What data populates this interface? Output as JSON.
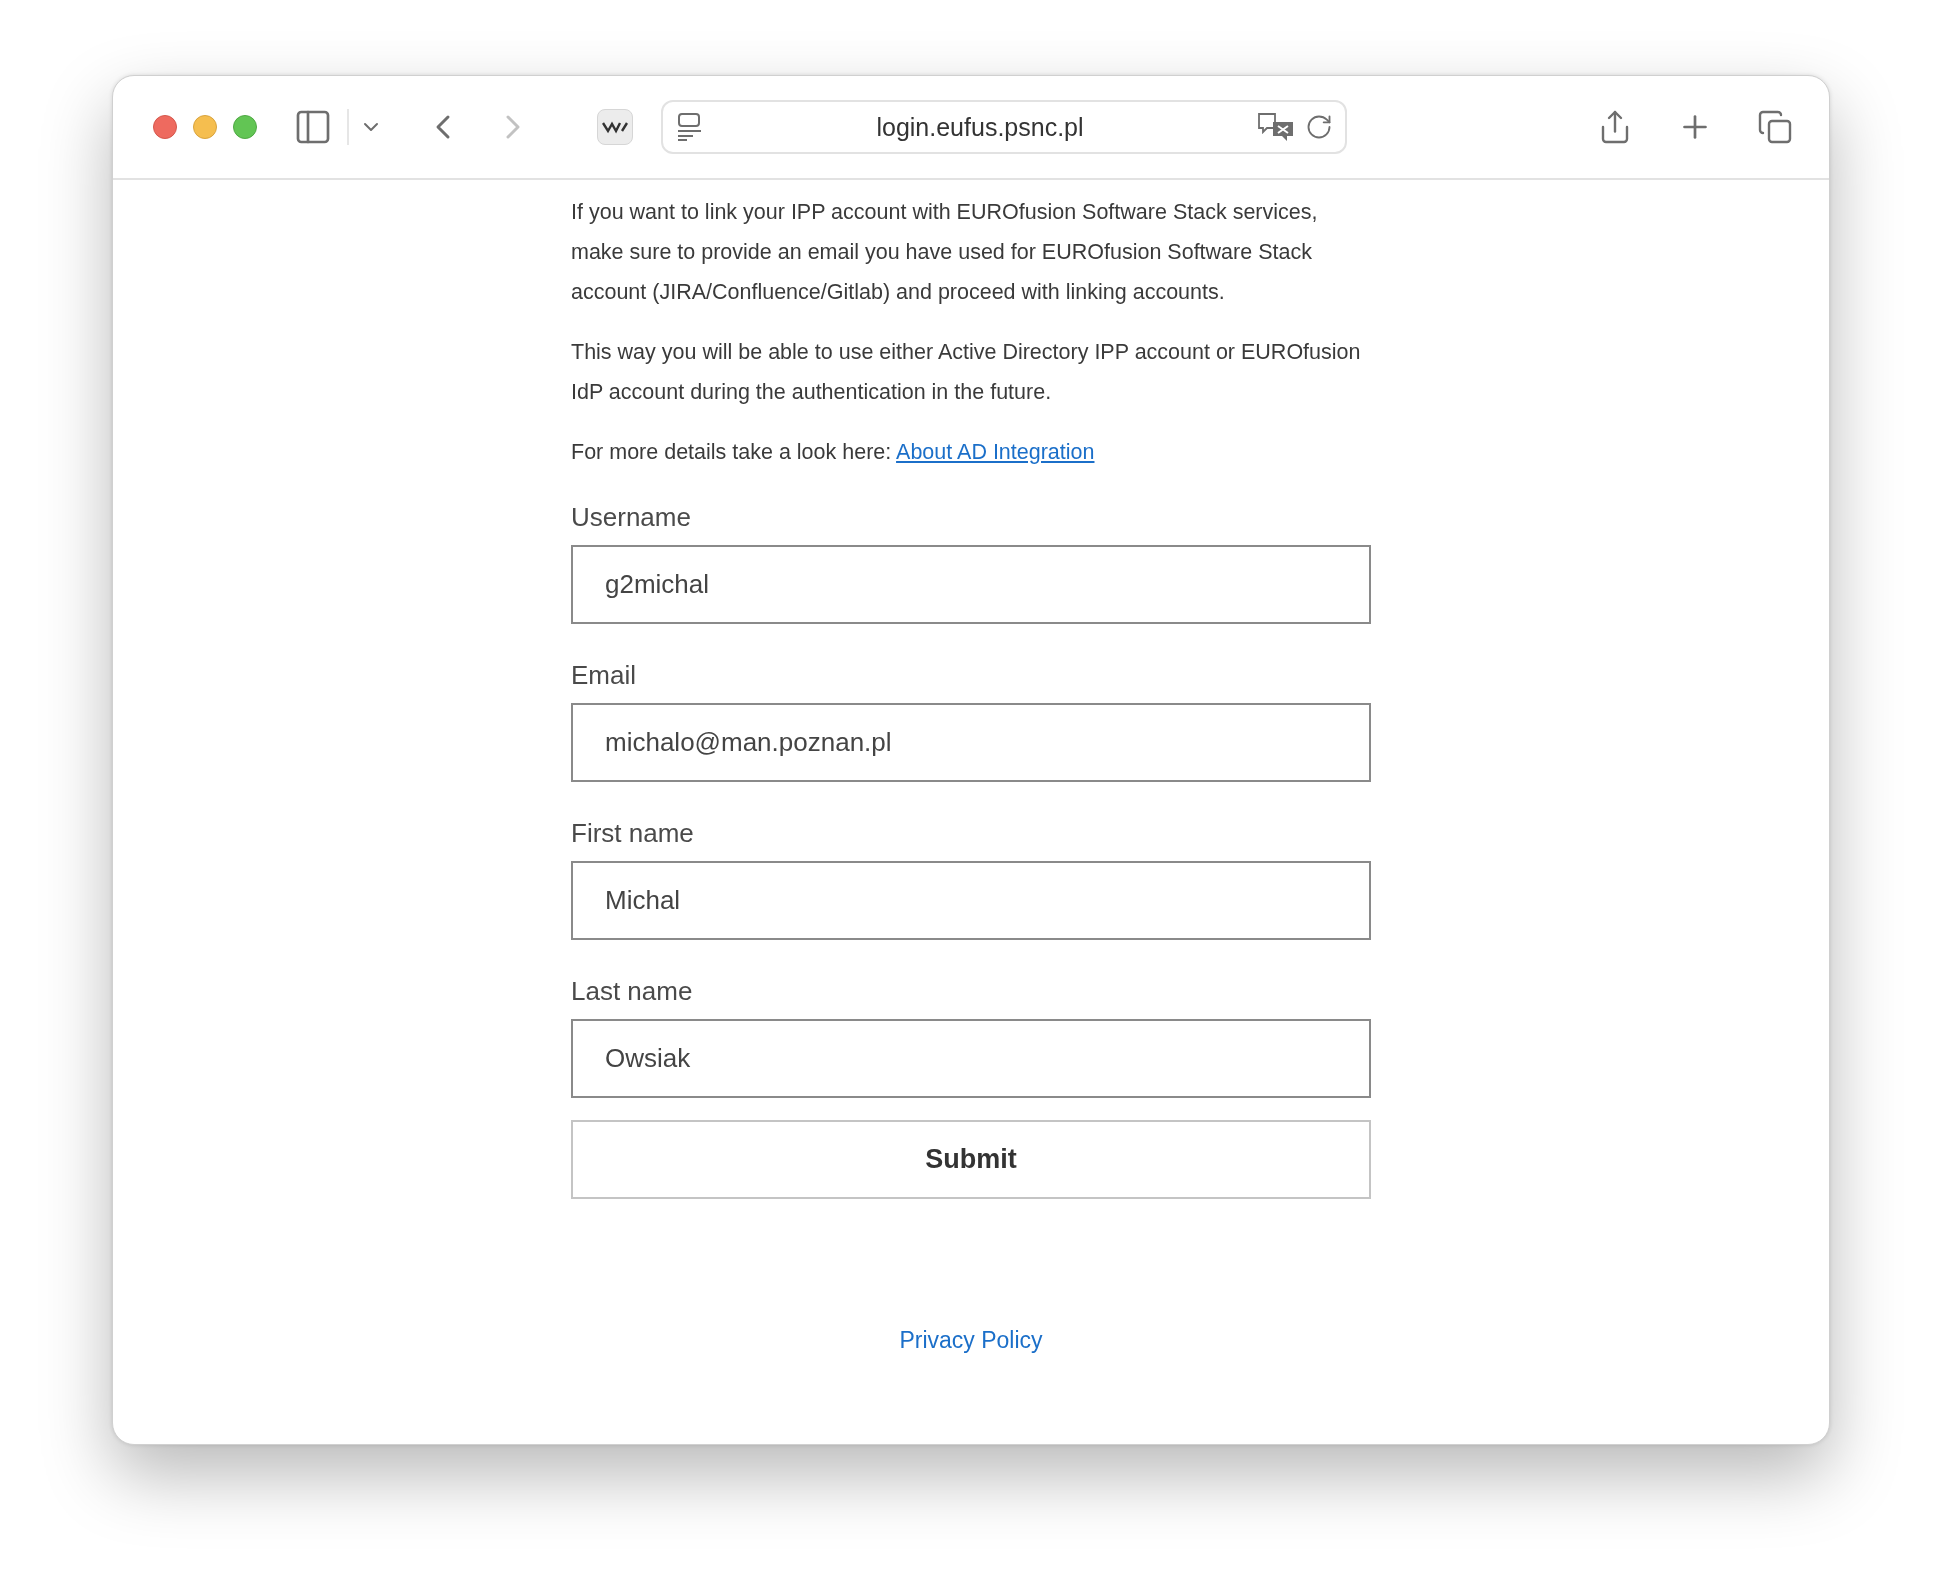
{
  "browser": {
    "url": "login.eufus.psnc.pl",
    "forward_disabled": true
  },
  "paragraphs": [
    "If you want to link your IPP account with EUROfusion Software Stack services, make sure to provide an email you have used for EUROfusion Software Stack account (JIRA/Confluence/Gitlab) and proceed with linking accounts.",
    "This way you will be able to use either Active Directory IPP account or EUROfusion IdP account during the authentication in the future."
  ],
  "details": {
    "text": "For more details take a look here:",
    "link": "About AD Integration"
  },
  "fields": [
    {
      "label": "Username",
      "value": "g2michal"
    },
    {
      "label": "Email",
      "value": "michalo@man.poznan.pl"
    },
    {
      "label": "First name",
      "value": "Michal"
    },
    {
      "label": "Last name",
      "value": "Owsiak"
    }
  ],
  "submit": "Submit",
  "footer_link": "Privacy Policy"
}
